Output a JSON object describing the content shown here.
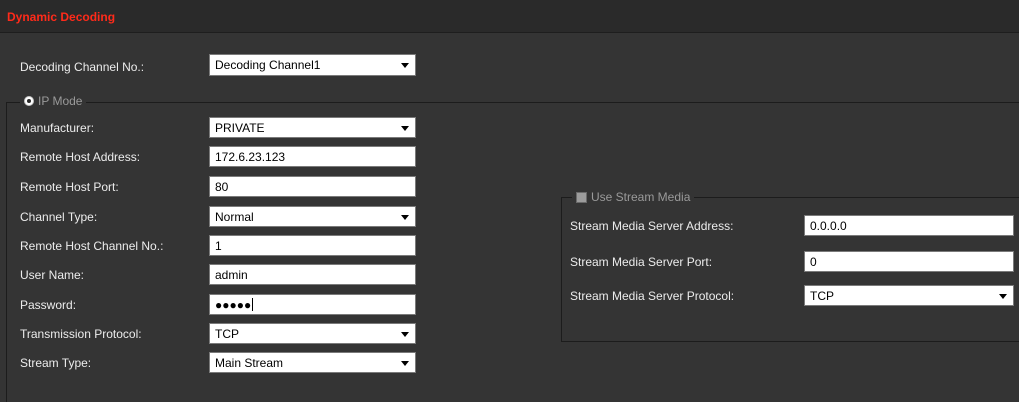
{
  "window": {
    "title": "Dynamic Decoding"
  },
  "decoding_channel": {
    "label": "Decoding Channel No.:",
    "value": "Decoding Channel1"
  },
  "ip_mode": {
    "legend": "IP Mode",
    "manufacturer": {
      "label": "Manufacturer:",
      "value": "PRIVATE"
    },
    "remote_host_address": {
      "label": "Remote Host Address:",
      "value": "172.6.23.123"
    },
    "remote_host_port": {
      "label": "Remote Host Port:",
      "value": "80"
    },
    "channel_type": {
      "label": "Channel Type:",
      "value": "Normal"
    },
    "remote_host_channel_no": {
      "label": "Remote Host Channel No.:",
      "value": "1"
    },
    "user_name": {
      "label": "User Name:",
      "value": "admin"
    },
    "password": {
      "label": "Password:",
      "value": "●●●●●"
    },
    "transmission_protocol": {
      "label": "Transmission Protocol:",
      "value": "TCP"
    },
    "stream_type": {
      "label": "Stream Type:",
      "value": "Main Stream"
    }
  },
  "stream_media": {
    "legend": "Use Stream Media",
    "server_address": {
      "label": "Stream Media Server Address:",
      "value": "0.0.0.0"
    },
    "server_port": {
      "label": "Stream Media Server Port:",
      "value": "0"
    },
    "server_protocol": {
      "label": "Stream Media Server Protocol:",
      "value": "TCP"
    }
  },
  "colors": {
    "title_red": "#ff2a1a",
    "background": "#343434",
    "field_background": "#ffffff"
  },
  "icons": {
    "ip_mode_radio": "radio-selected",
    "stream_media_checkbox": "checkbox-disabled",
    "dropdown": "caret-down"
  }
}
